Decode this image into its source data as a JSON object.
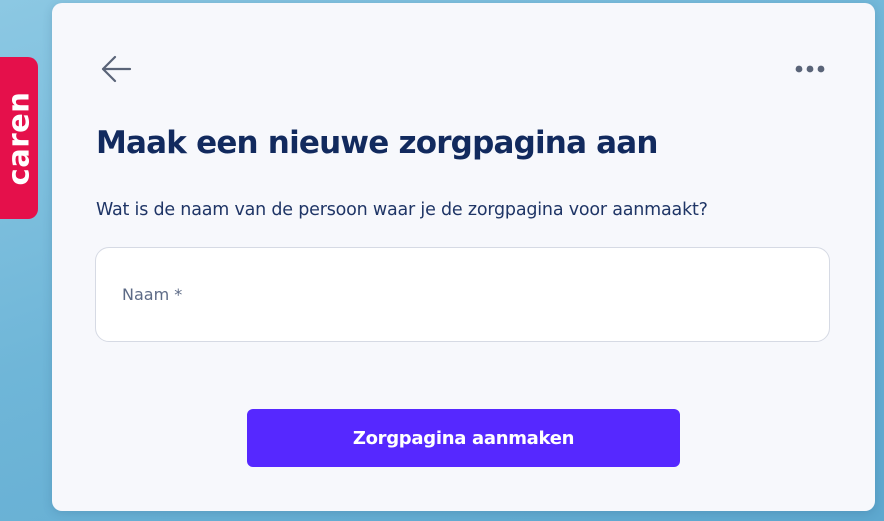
{
  "brand": {
    "logo_text": "caren",
    "color": "#e5104b"
  },
  "header": {
    "back_icon": "arrow-left-icon",
    "more_icon": "more-horizontal-icon"
  },
  "page": {
    "title": "Maak een nieuwe zorgpagina aan",
    "question": "Wat is de naam van de persoon waar je de zorgpagina voor aanmaakt?"
  },
  "form": {
    "name_field": {
      "placeholder": "Naam *",
      "value": ""
    },
    "submit_label": "Zorgpagina aanmaken"
  },
  "colors": {
    "accent": "#5628ff",
    "title": "#122a5e",
    "background": "#7fbfe0",
    "card": "#f7f8fc"
  }
}
